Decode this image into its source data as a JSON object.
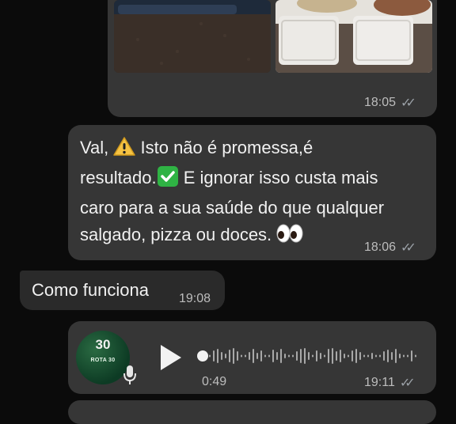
{
  "photo_message": {
    "time": "18:05"
  },
  "message_1": {
    "line1_pre": "Val, ",
    "line1_post": " Isto não é promessa,é",
    "line2_pre": "resultado.",
    "line2_post": " E ignorar isso custa mais",
    "line3": "caro para a sua saúde do que qualquer",
    "line4": "salgado, pizza ou doces.",
    "time": "18:06"
  },
  "message_2": {
    "text": "Como funciona",
    "time": "19:08"
  },
  "voice_message": {
    "avatar_number": "30",
    "avatar_label": "ROTA 30",
    "duration": "0:49",
    "time": "19:11",
    "progress": 0
  },
  "colors": {
    "background": "#0b0b0b",
    "outgoing_bubble": "#363636",
    "incoming_bubble": "#2a2a2a",
    "checkmark": "#2fb344"
  },
  "icons": [
    "warning-emoji",
    "checkmark-emoji",
    "eyes-emoji",
    "read-ticks-icon",
    "play-icon",
    "mic-icon"
  ]
}
